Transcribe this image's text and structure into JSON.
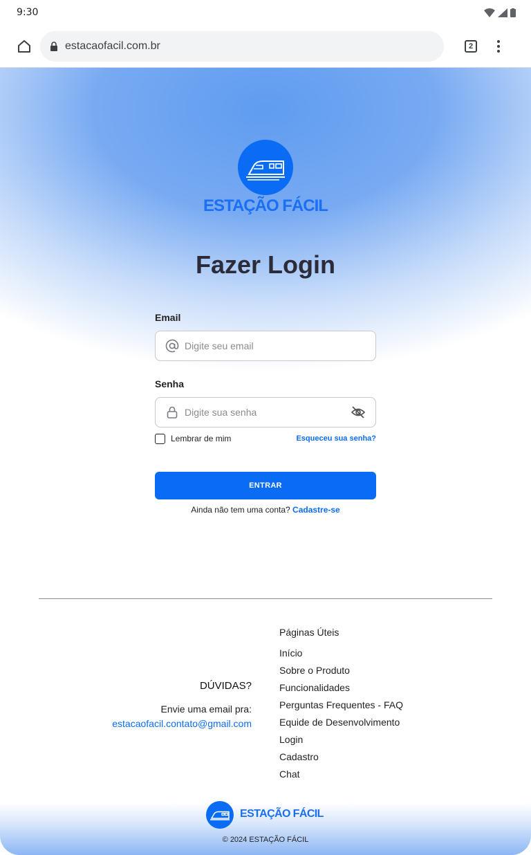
{
  "status_bar": {
    "time": "9:30"
  },
  "browser": {
    "url": "estacaofacil.com.br",
    "tab_count": "2"
  },
  "brand": {
    "name": "ESTAÇÃO FÁCIL",
    "color": "#0a6cf5"
  },
  "login": {
    "title": "Fazer Login",
    "email_label": "Email",
    "email_placeholder": "Digite seu email",
    "password_label": "Senha",
    "password_placeholder": "Digite sua senha",
    "remember_label": "Lembrar de mim",
    "forgot_link": "Esqueceu sua senha?",
    "submit_label": "ENTRAR",
    "signup_prompt": "Ainda não tem uma conta?",
    "signup_link": "Cadastre-se"
  },
  "footer": {
    "doubts_title": "DÚVIDAS?",
    "doubts_text": "Envie uma email pra:",
    "contact_email": "estacaofacil.contato@gmail.com",
    "links_title": "Páginas Úteis",
    "links": [
      "Início",
      "Sobre o Produto",
      "Funcionalidades",
      "Perguntas Frequentes - FAQ",
      "Equide de Desenvolvimento",
      "Login",
      "Cadastro",
      "Chat"
    ],
    "copyright": "© 2024 ESTAÇÃO FÁCIL"
  }
}
